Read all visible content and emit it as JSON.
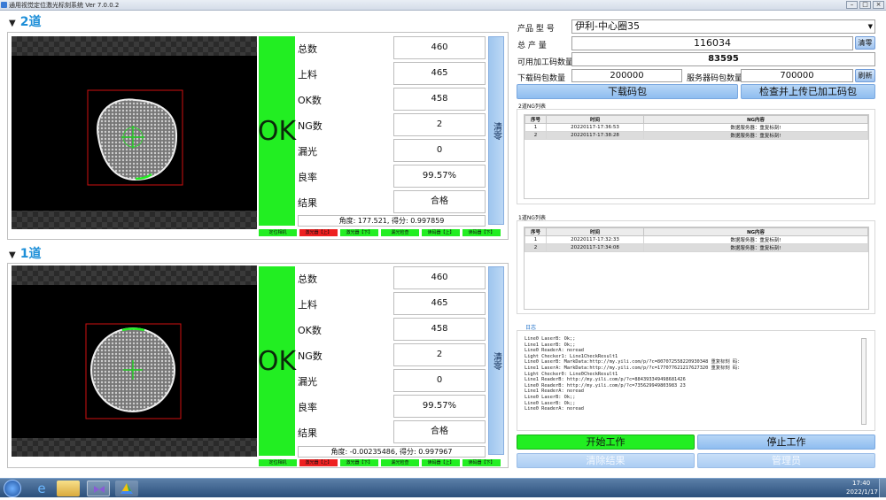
{
  "window": {
    "title": "通用视觉定位激光标刻系统 Ver 7.0.0.2",
    "controls": [
      "–",
      "□",
      "×"
    ]
  },
  "lanes": [
    {
      "title": "2道",
      "result": "OK",
      "clear_label": "清零",
      "stats": [
        {
          "label": "总数",
          "value": "460"
        },
        {
          "label": "上料",
          "value": "465"
        },
        {
          "label": "OK数",
          "value": "458"
        },
        {
          "label": "NG数",
          "value": "2"
        },
        {
          "label": "漏光",
          "value": "0"
        },
        {
          "label": "良率",
          "value": "99.57%"
        },
        {
          "label": "结果",
          "value": "合格"
        }
      ],
      "angle_text": "角度: 177.521, 得分: 0.997859",
      "indicators": [
        {
          "label": "定位相机",
          "color": "#22ee22"
        },
        {
          "label": "激光器【上】",
          "color": "#ee2020"
        },
        {
          "label": "激光器【下】",
          "color": "#22ee22"
        },
        {
          "label": "漏光检查",
          "color": "#22ee22"
        },
        {
          "label": "读码器【上】",
          "color": "#22ee22"
        },
        {
          "label": "读码器【下】",
          "color": "#22ee22"
        }
      ]
    },
    {
      "title": "1道",
      "result": "OK",
      "clear_label": "清零",
      "stats": [
        {
          "label": "总数",
          "value": "460"
        },
        {
          "label": "上料",
          "value": "465"
        },
        {
          "label": "OK数",
          "value": "458"
        },
        {
          "label": "NG数",
          "value": "2"
        },
        {
          "label": "漏光",
          "value": "0"
        },
        {
          "label": "良率",
          "value": "99.57%"
        },
        {
          "label": "结果",
          "value": "合格"
        }
      ],
      "angle_text": "角度: -0.00235486, 得分: 0.997967",
      "indicators": [
        {
          "label": "定位相机",
          "color": "#22ee22"
        },
        {
          "label": "激光器【上】",
          "color": "#ee2020"
        },
        {
          "label": "激光器【下】",
          "color": "#22ee22"
        },
        {
          "label": "漏光检查",
          "color": "#22ee22"
        },
        {
          "label": "读码器【上】",
          "color": "#22ee22"
        },
        {
          "label": "读码器【下】",
          "color": "#22ee22"
        }
      ]
    }
  ],
  "right": {
    "model_label": "产品 型 号",
    "model_value": "伊利-中心圈35",
    "total_label": "总 产 量",
    "total_value": "116034",
    "clear_btn": "清零",
    "avail_label": "可用加工码数量",
    "avail_value": "83595",
    "download_count_label": "下载码包数量",
    "download_count_value": "200000",
    "server_count_label": "服务器码包数量",
    "server_count_value": "700000",
    "refresh_btn": "刷新",
    "download_btn": "下载码包",
    "check_btn": "检查并上传已加工码包",
    "ng2_title": "2道NG列表",
    "ng1_title": "1道NG列表",
    "ng_headers": [
      "序号",
      "时间",
      "NG内容"
    ],
    "ng2_rows": [
      [
        "1",
        "20220117-17:36:53",
        "数据服务器：重复标刻!"
      ],
      [
        "2",
        "20220117-17:38:28",
        "数据服务器：重复标刻!"
      ]
    ],
    "ng1_rows": [
      [
        "1",
        "20220117-17:32:33",
        "数据服务器：重复标刻!"
      ],
      [
        "2",
        "20220117-17:34:08",
        "数据服务器：重复标刻!"
      ]
    ],
    "log_title": "日志",
    "log_lines": [
      "Line0 LaserB: Ok;;",
      "Line1 LaserB: Ok;;",
      "Line0 ReaderA: noread",
      "Light Checker1: Line1CheckResult1",
      "Line0 LaserB: MarkData:http://my.yili.com/p/?c=807072558220930348 重复标刻 码:",
      "Line1 LaserA: MarkData:http://my.yili.com/p/?c=177077621217627320 重复标刻 码:",
      "Light Checker0: Line0CheckResult1",
      "Line1 ReaderB: http://my.yili.com/p/?c=884393349498681426",
      "Line0 ReaderB: http://my.yili.com/p/?c=735629949803983 23",
      "Line1 ReaderA: noread",
      "Line0 LaserB: Ok;;",
      "Line0 LaserB: Ok;;",
      "Line0 ReaderA: noread"
    ],
    "start_btn": "开始工作",
    "stop_btn": "停止工作",
    "clear_result_btn": "清除结果",
    "admin_btn": "管理员"
  },
  "taskbar": {
    "time": "17:40",
    "date": "2022/1/17"
  }
}
